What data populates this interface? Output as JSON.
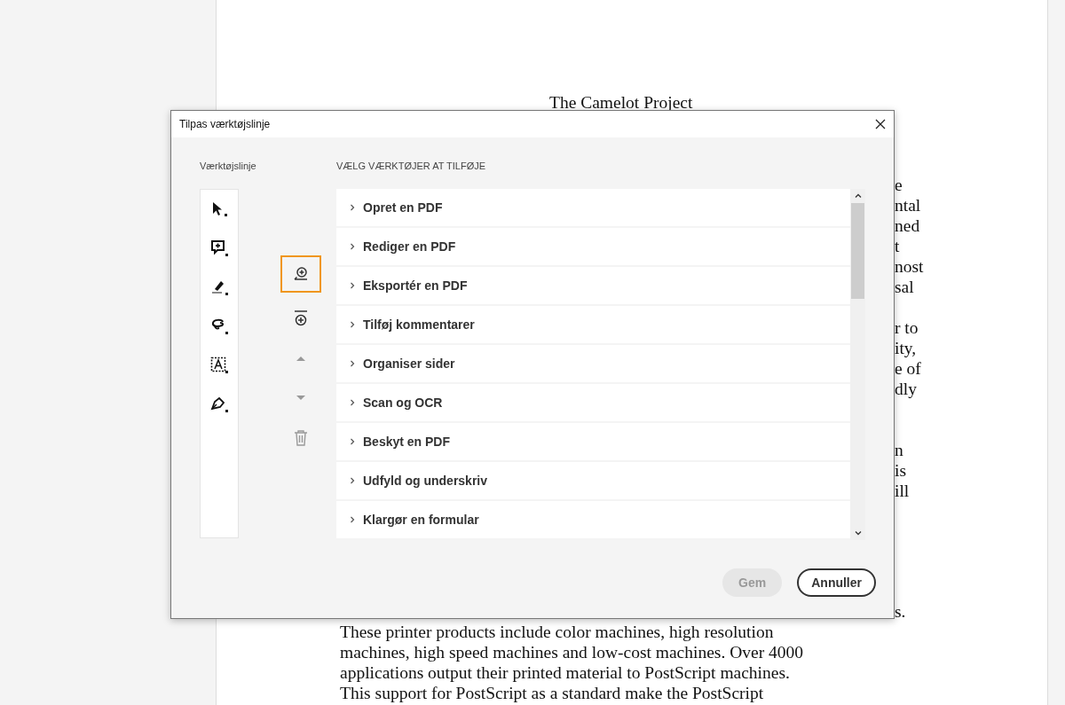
{
  "document": {
    "title": "The Camelot Project",
    "fragment_paragraphs": [
      [
        "e",
        "ntal",
        "ned",
        "t",
        "nost",
        "sal"
      ],
      [
        "r to",
        "ity,",
        "e of",
        "dly"
      ],
      [
        "n",
        "is",
        "ill"
      ]
    ],
    "fragment_bottom": "s.",
    "lines": [
      "These printer products include color machines, high resolution",
      "machines, high speed machines and low-cost machines. Over 4000",
      "applications output their printed material to PostScript machines.",
      "This support for PostScript as a standard make the PostScript"
    ]
  },
  "dialog": {
    "title": "Tilpas værktøjslinje",
    "toolbar_label": "Værktøjslinje",
    "tools_heading": "VÆLG VÆRKTØJER AT TILFØJE",
    "side_buttons": [
      {
        "kind": "add_below",
        "disabled": false,
        "focused": true
      },
      {
        "kind": "add_above",
        "disabled": false,
        "focused": false
      },
      {
        "kind": "move_up",
        "disabled": true,
        "focused": false
      },
      {
        "kind": "move_down",
        "disabled": true,
        "focused": false
      },
      {
        "kind": "delete",
        "disabled": true,
        "focused": false
      }
    ],
    "tools": [
      {
        "label": "Opret en PDF",
        "expanded": false
      },
      {
        "label": "Rediger en PDF",
        "expanded": false
      },
      {
        "label": "Eksportér en PDF",
        "expanded": false
      },
      {
        "label": "Tilføj kommentarer",
        "expanded": false
      },
      {
        "label": "Organiser sider",
        "expanded": false
      },
      {
        "label": "Scan og OCR",
        "expanded": false
      },
      {
        "label": "Beskyt en PDF",
        "expanded": false
      },
      {
        "label": "Udfyld og underskriv",
        "expanded": false
      },
      {
        "label": "Klargør en formular",
        "expanded": false
      }
    ],
    "buttons": [
      {
        "label": "Gem",
        "disabled": true
      },
      {
        "label": "Annuller",
        "disabled": false
      }
    ]
  }
}
